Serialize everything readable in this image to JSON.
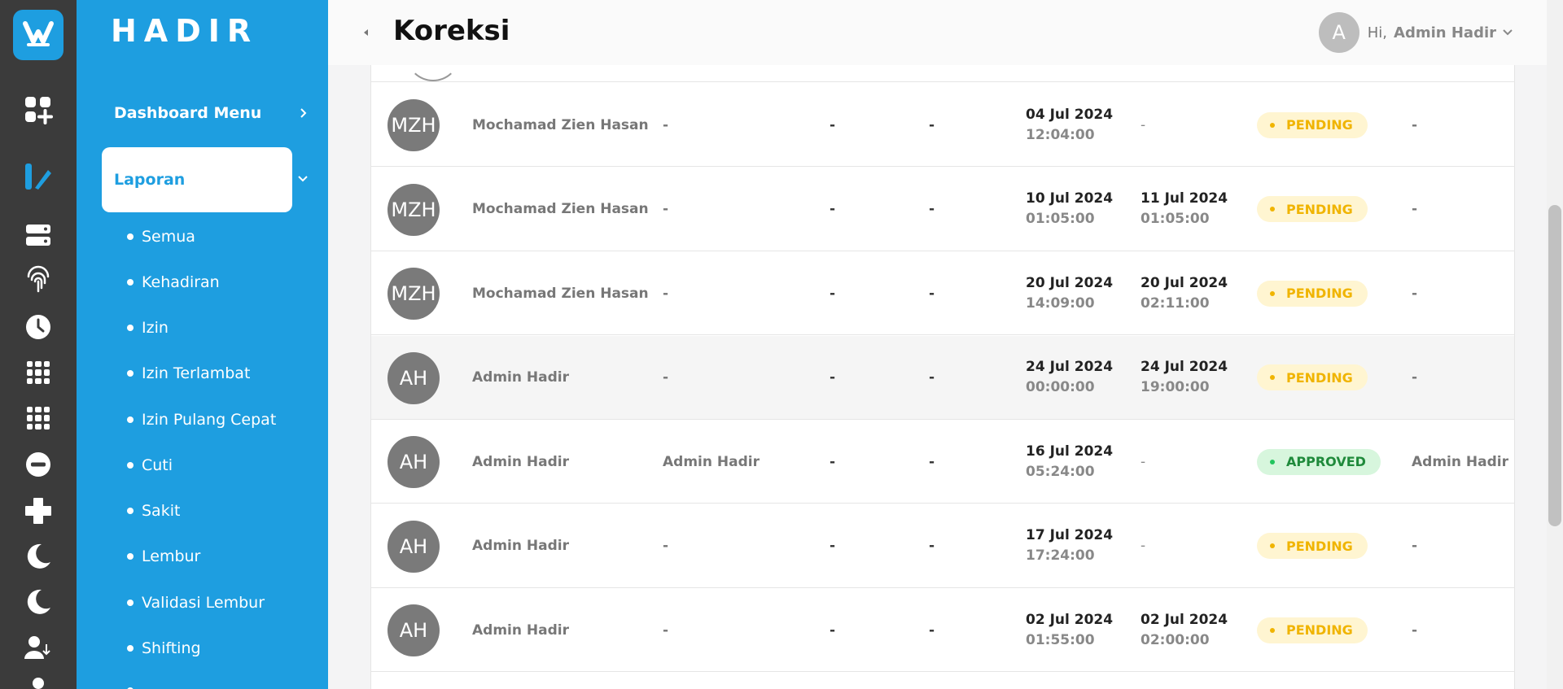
{
  "brand": "HADIR",
  "header": {
    "title": "Koreksi",
    "greeting": "Hi,",
    "user_name": "Admin Hadir",
    "user_initial": "A"
  },
  "sidebar": {
    "dashboard_label": "Dashboard Menu",
    "laporan_label": "Laporan",
    "items": [
      "Semua",
      "Kehadiran",
      "Izin",
      "Izin Terlambat",
      "Izin Pulang Cepat",
      "Cuti",
      "Sakit",
      "Lembur",
      "Validasi Lembur",
      "Shifting"
    ]
  },
  "rail_icons": [
    "dashboard-add-icon",
    "laporan-icon",
    "server-icon",
    "fingerprint-icon",
    "clock-icon",
    "grid-icon",
    "grid-icon-2",
    "minus-circle-icon",
    "plus-icon",
    "moon-icon",
    "moon-icon-2",
    "user-swap-icon",
    "user-icon"
  ],
  "colors": {
    "primary": "#1e9ee0",
    "rail": "#3b3b3b",
    "pending": "#f0b400",
    "approved": "#1f8a3b"
  },
  "rows": [
    {
      "initials": "MZH",
      "name": "Mochamad Zien Hasan",
      "approver": "-",
      "c1": "-",
      "c2": "-",
      "in_date": "04 Jul 2024",
      "in_time": "12:04:00",
      "out_date": "-",
      "out_time": "",
      "status": "PENDING",
      "action": "-"
    },
    {
      "initials": "MZH",
      "name": "Mochamad Zien Hasan",
      "approver": "-",
      "c1": "-",
      "c2": "-",
      "in_date": "10 Jul 2024",
      "in_time": "01:05:00",
      "out_date": "11 Jul 2024",
      "out_time": "01:05:00",
      "status": "PENDING",
      "action": "-"
    },
    {
      "initials": "MZH",
      "name": "Mochamad Zien Hasan",
      "approver": "-",
      "c1": "-",
      "c2": "-",
      "in_date": "20 Jul 2024",
      "in_time": "14:09:00",
      "out_date": "20 Jul 2024",
      "out_time": "02:11:00",
      "status": "PENDING",
      "action": "-"
    },
    {
      "initials": "AH",
      "name": "Admin Hadir",
      "approver": "-",
      "c1": "-",
      "c2": "-",
      "in_date": "24 Jul 2024",
      "in_time": "00:00:00",
      "out_date": "24 Jul 2024",
      "out_time": "19:00:00",
      "status": "PENDING",
      "action": "-"
    },
    {
      "initials": "AH",
      "name": "Admin Hadir",
      "approver": "Admin Hadir",
      "c1": "-",
      "c2": "-",
      "in_date": "16 Jul 2024",
      "in_time": "05:24:00",
      "out_date": "-",
      "out_time": "",
      "status": "APPROVED",
      "action": "Admin Hadir"
    },
    {
      "initials": "AH",
      "name": "Admin Hadir",
      "approver": "-",
      "c1": "-",
      "c2": "-",
      "in_date": "17 Jul 2024",
      "in_time": "17:24:00",
      "out_date": "-",
      "out_time": "",
      "status": "PENDING",
      "action": "-"
    },
    {
      "initials": "AH",
      "name": "Admin Hadir",
      "approver": "-",
      "c1": "-",
      "c2": "-",
      "in_date": "02 Jul 2024",
      "in_time": "01:55:00",
      "out_date": "02 Jul 2024",
      "out_time": "02:00:00",
      "status": "PENDING",
      "action": "-"
    }
  ]
}
